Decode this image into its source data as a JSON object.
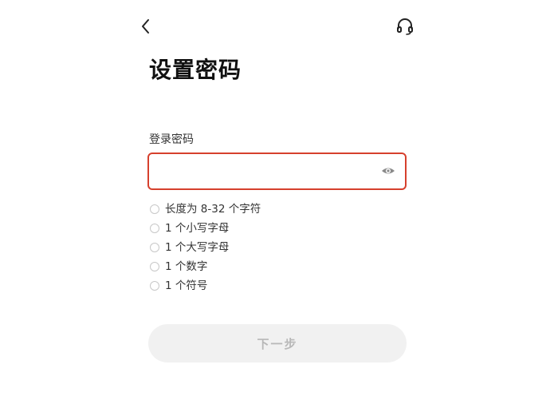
{
  "header": {
    "back_icon": "chevron-left-icon",
    "support_icon": "headset-icon"
  },
  "title": "设置密码",
  "password_field": {
    "label": "登录密码",
    "value": "",
    "placeholder": "",
    "visibility_icon": "eye-icon",
    "border_color": "#d6402d"
  },
  "rules": [
    {
      "text": "长度为 8-32 个字符",
      "met": false
    },
    {
      "text": "1 个小写字母",
      "met": false
    },
    {
      "text": "1 个大写字母",
      "met": false
    },
    {
      "text": "1 个数字",
      "met": false
    },
    {
      "text": "1 个符号",
      "met": false
    }
  ],
  "next_button": {
    "label": "下一步",
    "enabled": false
  },
  "colors": {
    "error_border": "#d6402d",
    "disabled_button_bg": "#f1f1f1",
    "disabled_button_text": "#b8b8b8"
  }
}
